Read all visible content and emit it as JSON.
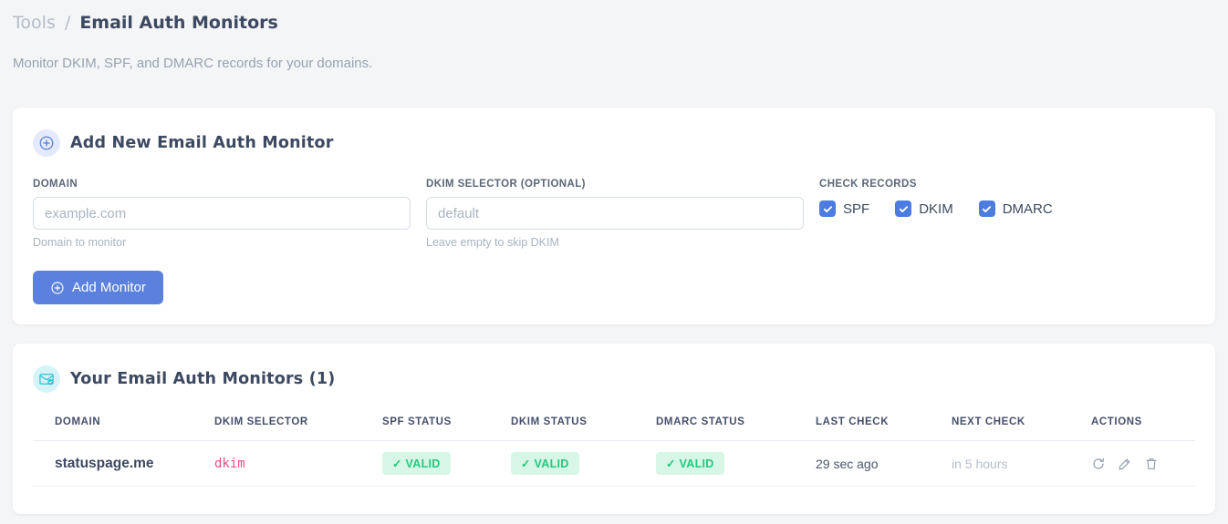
{
  "page": {
    "breadcrumb": {
      "parent": "Tools",
      "separator": "/",
      "current": "Email Auth Monitors"
    },
    "subtitle": "Monitor DKIM, SPF, and DMARC records for your domains."
  },
  "add_monitor_card": {
    "icon": "plus-circle-icon",
    "title": "Add New Email Auth Monitor",
    "fields": {
      "domain": {
        "label": "DOMAIN",
        "placeholder": "example.com",
        "value": "",
        "hint": "Domain to monitor"
      },
      "dkim_selector": {
        "label": "DKIM SELECTOR (OPTIONAL)",
        "placeholder": "default",
        "value": "",
        "hint": "Leave empty to skip DKIM"
      }
    },
    "check_records": {
      "label": "CHECK RECORDS",
      "options": [
        {
          "label": "SPF",
          "checked": true
        },
        {
          "label": "DKIM",
          "checked": true
        },
        {
          "label": "DMARC",
          "checked": true
        }
      ]
    },
    "submit_label": "Add Monitor"
  },
  "monitors_card": {
    "icon": "envelope-check-icon",
    "title": "Your Email Auth Monitors (1)",
    "count": 1,
    "table": {
      "headers": [
        "DOMAIN",
        "DKIM SELECTOR",
        "SPF STATUS",
        "DKIM STATUS",
        "DMARC STATUS",
        "LAST CHECK",
        "NEXT CHECK",
        "ACTIONS"
      ],
      "rows": [
        {
          "domain": "statuspage.me",
          "dkim_selector": "dkim",
          "spf_status": "✓ VALID",
          "dkim_status": "✓ VALID",
          "dmarc_status": "✓ VALID",
          "last_check": "29 sec ago",
          "next_check": "in 5 hours",
          "actions": [
            "refresh-icon",
            "edit-icon",
            "delete-icon"
          ]
        }
      ]
    }
  },
  "colors": {
    "accent_blue": "#5b80dd",
    "checkbox_blue": "#4c7ce0",
    "badge_green_bg": "#d7f6e6",
    "badge_green_text": "#23c97e",
    "selector_pink": "#ea4c82",
    "teal_icon": "#2ec0d4",
    "page_bg": "#f4f5f7"
  }
}
